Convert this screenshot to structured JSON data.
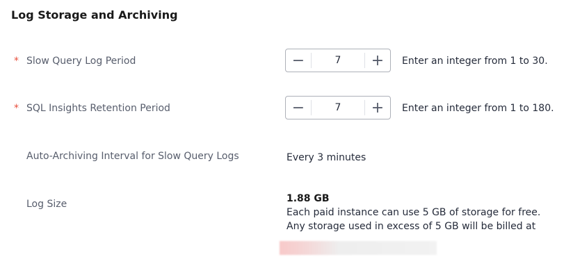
{
  "section": {
    "title": "Log Storage and Archiving"
  },
  "slow_query": {
    "required_mark": "*",
    "label": "Slow Query Log Period",
    "decrement": "−",
    "value": "7",
    "increment": "+",
    "hint": "Enter an integer from 1 to 30."
  },
  "sql_insights": {
    "required_mark": "*",
    "label": "SQL Insights Retention Period",
    "decrement": "−",
    "value": "7",
    "increment": "+",
    "hint": "Enter an integer from 1 to 180."
  },
  "auto_archiving": {
    "label": "Auto-Archiving Interval for Slow Query Logs",
    "value": "Every 3 minutes"
  },
  "log_size": {
    "label": "Log Size",
    "value": "1.88 GB",
    "line1": "Each paid instance can use 5 GB of storage for free.",
    "line2": "Any storage used in excess of 5 GB will be billed at"
  }
}
